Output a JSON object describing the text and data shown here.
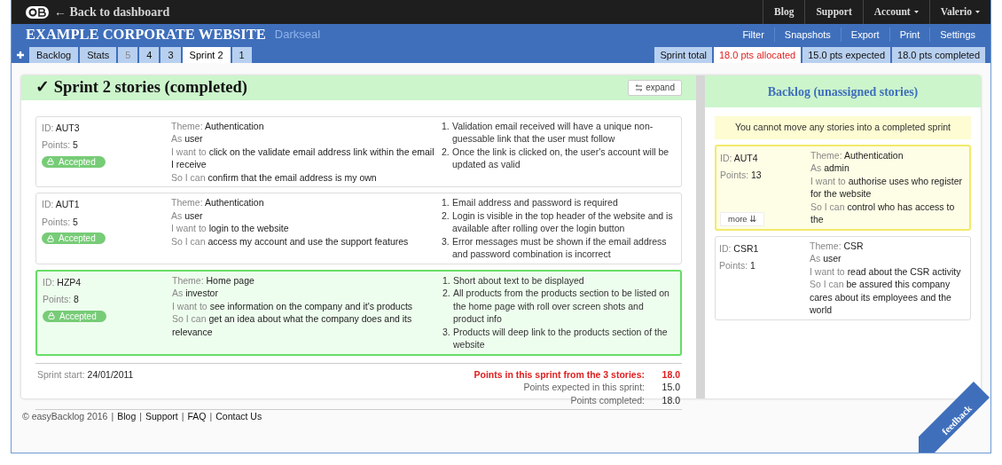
{
  "topbar": {
    "back_link": "← Back to dashboard",
    "menu": [
      {
        "label": "Blog",
        "dropdown": false
      },
      {
        "label": "Support",
        "dropdown": false
      },
      {
        "label": "Account",
        "dropdown": true
      },
      {
        "label": "Valerio",
        "dropdown": true
      }
    ]
  },
  "header": {
    "title": "EXAMPLE CORPORATE WEBSITE",
    "subtitle": "Darkseal",
    "actions": [
      "Filter",
      "Snapshots",
      "Export",
      "Print",
      "Settings"
    ]
  },
  "tabs": [
    {
      "label": "Backlog",
      "selected": false,
      "faded": false
    },
    {
      "label": "Stats",
      "selected": false,
      "faded": false
    },
    {
      "label": "5",
      "selected": false,
      "faded": true
    },
    {
      "label": "4",
      "selected": false,
      "faded": false
    },
    {
      "label": "3",
      "selected": false,
      "faded": false
    },
    {
      "label": "Sprint 2",
      "selected": true,
      "faded": false
    },
    {
      "label": "1",
      "selected": false,
      "faded": false
    }
  ],
  "sprint_totals": [
    {
      "text": "Sprint total",
      "alert": false
    },
    {
      "text": "18.0 pts allocated",
      "alert": true
    },
    {
      "text": "15.0 pts expected",
      "alert": false
    },
    {
      "text": "18.0 pts completed",
      "alert": false
    }
  ],
  "sprint": {
    "title": "✓ Sprint 2 stories (completed)",
    "expand_button": "expand",
    "stories": [
      {
        "id_label": "ID:",
        "id": "AUT3",
        "points_label": "Points:",
        "points": "5",
        "status": "Accepted",
        "highlighted": false,
        "theme_label": "Theme:",
        "theme": "Authentication",
        "as_label": "As",
        "as": "user",
        "want_label": "I want to",
        "want": "click on the validate email address link within the email I receive",
        "so_label": "So I can",
        "so": "confirm that the email address is my own",
        "criteria": [
          {
            "number": "1.",
            "text": "Validation email received will have a unique non-guessable link that the user must follow"
          },
          {
            "number": "2.",
            "text": "Once the link is clicked on, the user's account will be updated as valid"
          }
        ]
      },
      {
        "id_label": "ID:",
        "id": "AUT1",
        "points_label": "Points:",
        "points": "5",
        "status": "Accepted",
        "highlighted": false,
        "theme_label": "Theme:",
        "theme": "Authentication",
        "as_label": "As",
        "as": "user",
        "want_label": "I want to",
        "want": "login to the website",
        "so_label": "So I can",
        "so": "access my account and use the support features",
        "criteria": [
          {
            "number": "1.",
            "text": "Email address and password is required"
          },
          {
            "number": "2.",
            "text": "Login is visible in the top header of the website and is available after rolling over the login button"
          },
          {
            "number": "3.",
            "text": "Error messages must be shown if the email address and password combination is incorrect"
          }
        ]
      },
      {
        "id_label": "ID:",
        "id": "HZP4",
        "points_label": "Points:",
        "points": "8",
        "status": "Accepted",
        "highlighted": true,
        "theme_label": "Theme:",
        "theme": "Home page",
        "as_label": "As",
        "as": "investor",
        "want_label": "I want to",
        "want": "see information on the company and it's products",
        "so_label": "So I can",
        "so": "get an idea about what the company does and its relevance",
        "criteria": [
          {
            "number": "1.",
            "text": "Short about text to be displayed"
          },
          {
            "number": "2.",
            "text": "All products from the products section to be listed on the home page with roll over screen shots and product info"
          },
          {
            "number": "3.",
            "text": "Products will deep link to the products section of the website"
          }
        ]
      }
    ],
    "start_label": "Sprint start:",
    "start_date": "24/01/2011",
    "summary": [
      {
        "label": "Points in this sprint from the 3 stories:",
        "value": "18.0",
        "alert": true
      },
      {
        "label": "Points expected in this sprint:",
        "value": "15.0",
        "alert": false
      },
      {
        "label": "Points completed:",
        "value": "18.0",
        "alert": false
      }
    ]
  },
  "backlog": {
    "title": "Backlog (unassigned stories)",
    "notice": "You cannot move any stories into a completed sprint",
    "stories": [
      {
        "id_label": "ID:",
        "id": "AUT4",
        "points_label": "Points:",
        "points": "13",
        "highlighted": true,
        "more": "more ⇊",
        "theme_label": "Theme:",
        "theme": "Authentication",
        "as_label": "As",
        "as": "admin",
        "want_label": "I want to",
        "want": "authorise uses who register for the website",
        "so_label": "So I can",
        "so": "control who has access to the"
      },
      {
        "id_label": "ID:",
        "id": "CSR1",
        "points_label": "Points:",
        "points": "1",
        "highlighted": false,
        "theme_label": "Theme:",
        "theme": "CSR",
        "as_label": "As",
        "as": "user",
        "want_label": "I want to",
        "want": "read about the CSR activity",
        "so_label": "So I can",
        "so": "be assured this company cares about its employees and the world"
      }
    ]
  },
  "footer": {
    "copyright": "© easyBacklog 2016",
    "links": [
      {
        "separator": "|",
        "label": "Blog"
      },
      {
        "separator": "|",
        "label": "Support"
      },
      {
        "separator": "|",
        "label": "FAQ"
      },
      {
        "separator": "|",
        "label": "Contact Us"
      }
    ],
    "feedback": "feedback"
  }
}
